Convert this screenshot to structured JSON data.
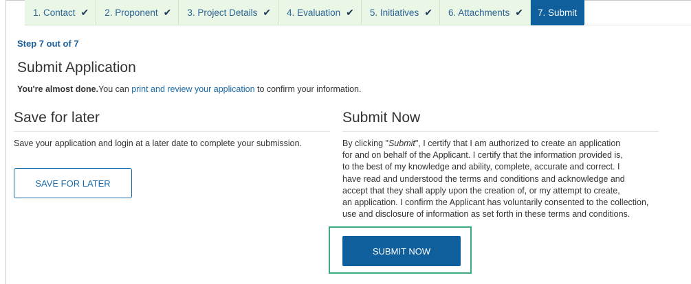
{
  "tabs": [
    {
      "label": "1. Contact",
      "done": true
    },
    {
      "label": "2. Proponent",
      "done": true
    },
    {
      "label": "3. Project Details",
      "done": true
    },
    {
      "label": "4. Evaluation",
      "done": true
    },
    {
      "label": "5. Initiatives",
      "done": true
    },
    {
      "label": "6. Attachments",
      "done": true
    },
    {
      "label": "7. Submit",
      "done": false,
      "active": true
    }
  ],
  "check_glyph": "✔",
  "step_text": "Step 7 out of 7",
  "title": "Submit Application",
  "intro": {
    "bold": "You're almost done.",
    "before_link": "You can ",
    "link": "print and review your application",
    "after_link": " to confirm your information."
  },
  "save_section": {
    "heading": "Save for later",
    "text": "Save your application and login at a later date to complete your submission.",
    "button": "SAVE FOR LATER"
  },
  "submit_section": {
    "heading": "Submit Now",
    "cert_prefix": "By clicking \"",
    "cert_em": "Submit",
    "cert_line1_rest": "\", I certify that I am authorized to create an application",
    "cert_lines": [
      "for and on behalf of the Applicant. I certify that the information provided is,",
      "to the best of my knowledge and ability, complete, accurate and correct. I",
      "have read and understood the terms and conditions and acknowledge and",
      "accept that they shall apply upon the creation of, or my attempt to create,",
      "an application. I confirm the Applicant has voluntarily consented to the collection,",
      "use and disclosure of information as set forth in these terms and conditions."
    ],
    "button": "SUBMIT NOW"
  },
  "colors": {
    "accent": "#0e5f9c",
    "link": "#1a6ba8",
    "tab_done_bg": "#eaf6e6",
    "highlight": "#3faa7e"
  }
}
